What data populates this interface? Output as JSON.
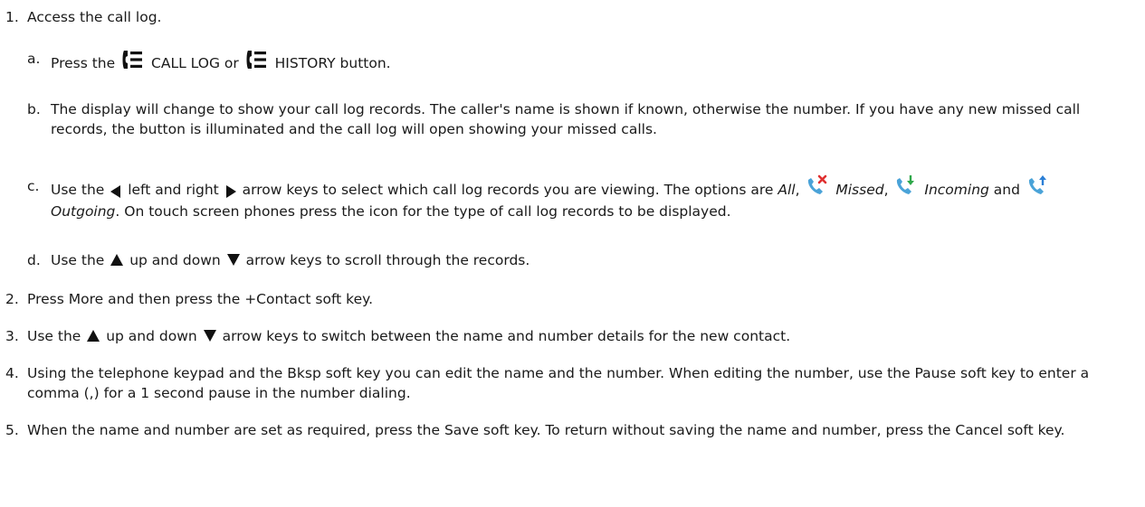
{
  "steps": [
    {
      "num": "1.",
      "text": "Access the call log."
    },
    {
      "num": "2.",
      "text": "Press More and then press the +Contact soft key."
    },
    {
      "num": "3.",
      "text_a": "Use the",
      "text_b": "up and down",
      "text_c": "arrow keys to switch between the name and number details for the new contact."
    },
    {
      "num": "4.",
      "text": "Using the telephone keypad and the Bksp soft key you can edit the name and the number. When editing the number, use the Pause soft key to enter a comma (,) for a 1 second pause in the number dialing."
    },
    {
      "num": "5.",
      "text": "When the name and number are set as required, press the Save soft key. To return without saving the name and number, press the Cancel soft key."
    }
  ],
  "substeps": [
    {
      "num": "a.",
      "text_a": "Press the",
      "text_b": "CALL LOG or",
      "text_c": "HISTORY button."
    },
    {
      "num": "b.",
      "text": "The display will change to show your call log records. The caller's name is shown if known, otherwise the number. If you have any new missed call records, the button is illuminated and the call log will open showing your missed calls."
    },
    {
      "num": "c.",
      "text_a": "Use the",
      "text_b": "left and right",
      "text_c": "arrow keys to select which call log records you are viewing. The options are",
      "opt_all": "All",
      "opt_missed": "Missed",
      "opt_incoming": "Incoming",
      "and": "and",
      "opt_outgoing": "Outgoing",
      "text_d": ". On touch screen phones press the icon for the type of call log records to be displayed."
    },
    {
      "num": "d.",
      "text_a": "Use the",
      "text_b": "up and down",
      "text_c": "arrow keys to scroll through the records."
    }
  ],
  "icons": {
    "call_log": "phone-list-icon",
    "arrow_left": "left-arrow-icon",
    "arrow_right": "right-arrow-icon",
    "arrow_up": "up-arrow-icon",
    "arrow_down": "down-arrow-icon",
    "missed": "missed-call-icon",
    "incoming": "incoming-call-icon",
    "outgoing": "outgoing-call-icon"
  },
  "colors": {
    "missed": "#e03030",
    "incoming": "#2fa84a",
    "outgoing": "#2b7fd6",
    "handset": "#4aa3d8"
  }
}
